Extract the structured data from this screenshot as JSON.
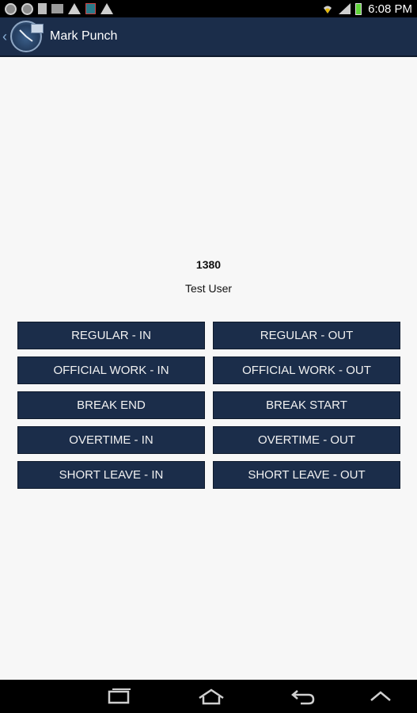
{
  "status_bar": {
    "time": "6:08 PM",
    "icons": [
      "sync-icon",
      "sync-icon",
      "document-icon",
      "image-icon",
      "warning-icon",
      "flag-icon",
      "warning-icon",
      "wifi-icon",
      "signal-icon",
      "battery-icon"
    ]
  },
  "action_bar": {
    "title": "Mark Punch"
  },
  "user": {
    "id": "1380",
    "name": "Test User"
  },
  "buttons": [
    {
      "label": "REGULAR - IN"
    },
    {
      "label": "REGULAR - OUT"
    },
    {
      "label": "OFFICIAL WORK - IN"
    },
    {
      "label": "OFFICIAL WORK - OUT"
    },
    {
      "label": "BREAK END"
    },
    {
      "label": "BREAK START"
    },
    {
      "label": "OVERTIME - IN"
    },
    {
      "label": "OVERTIME - OUT"
    },
    {
      "label": "SHORT LEAVE - IN"
    },
    {
      "label": "SHORT LEAVE - OUT"
    }
  ],
  "nav_bar": {
    "icons": [
      "recent-apps-icon",
      "home-icon",
      "back-icon",
      "menu-up-icon"
    ]
  },
  "colors": {
    "action_bar": "#1b2d4a",
    "button": "#1b2d4a",
    "background": "#f7f7f7"
  }
}
